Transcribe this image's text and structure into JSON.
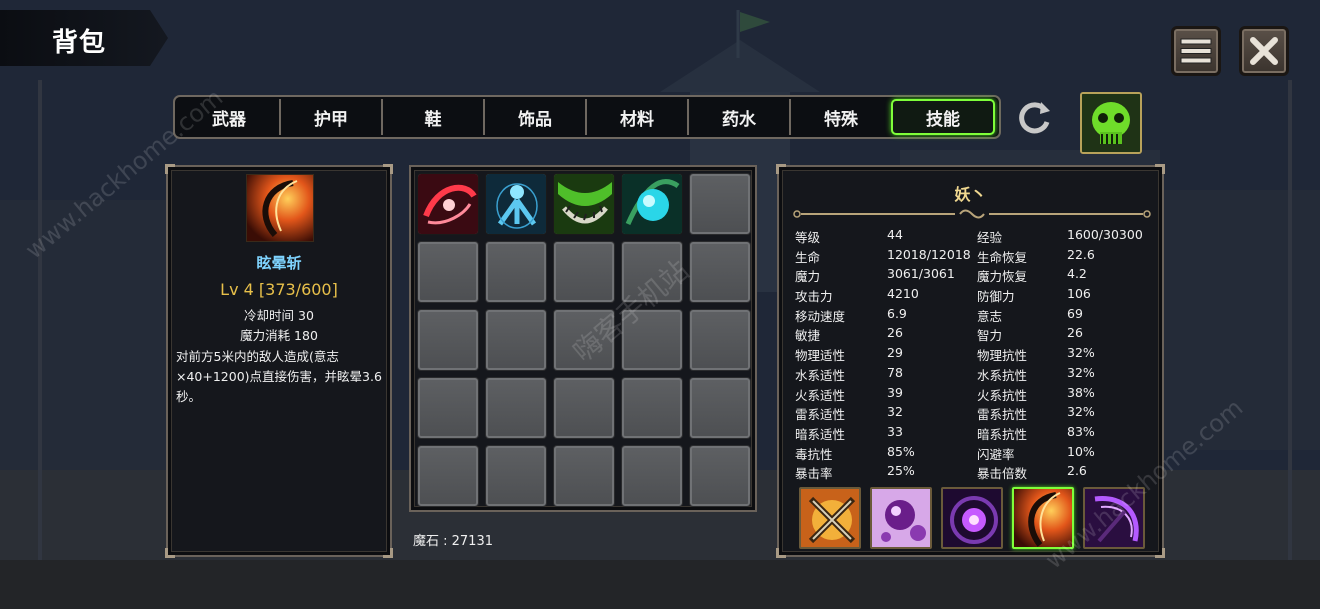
{
  "header": {
    "title": "背包"
  },
  "top_buttons": [
    {
      "icon": "menu-icon"
    },
    {
      "icon": "close-icon"
    }
  ],
  "tabs": [
    {
      "label": "武器",
      "active": false
    },
    {
      "label": "护甲",
      "active": false
    },
    {
      "label": "鞋",
      "active": false
    },
    {
      "label": "饰品",
      "active": false
    },
    {
      "label": "材料",
      "active": false
    },
    {
      "label": "药水",
      "active": false
    },
    {
      "label": "特殊",
      "active": false
    },
    {
      "label": "技能",
      "active": true
    }
  ],
  "skill_detail": {
    "name": "眩晕斩",
    "level": "Lv 4 [373/600]",
    "cooldown": "冷却时间 30",
    "mana_cost": "魔力消耗 180",
    "description": "对前方5米内的敌人造成(意志×40+1200)点直接伤害，并眩晕3.6秒。",
    "icon": "scythe-slash-icon"
  },
  "inventory": {
    "slots_total": 25,
    "filled_icons": [
      "red-slash-icon",
      "blue-spirit-icon",
      "green-jaw-icon",
      "cyan-orb-icon"
    ],
    "currency": "魔石 : 27131"
  },
  "character": {
    "name": "妖丶",
    "stats": [
      [
        "等级",
        "44",
        "经验",
        "1600/30300"
      ],
      [
        "生命",
        "12018/12018",
        "生命恢复",
        "22.6"
      ],
      [
        "魔力",
        "3061/3061",
        "魔力恢复",
        "4.2"
      ],
      [
        "攻击力",
        "4210",
        "防御力",
        "106"
      ],
      [
        "移动速度",
        "6.9",
        "意志",
        "69"
      ],
      [
        "敏捷",
        "26",
        "智力",
        "26"
      ],
      [
        "物理适性",
        "29",
        "物理抗性",
        "32%"
      ],
      [
        "水系适性",
        "78",
        "水系抗性",
        "32%"
      ],
      [
        "火系适性",
        "39",
        "火系抗性",
        "38%"
      ],
      [
        "雷系适性",
        "32",
        "雷系抗性",
        "32%"
      ],
      [
        "暗系适性",
        "33",
        "暗系抗性",
        "83%"
      ],
      [
        "毒抗性",
        "85%",
        "闪避率",
        "10%"
      ],
      [
        "暴击率",
        "25%",
        "暴击倍数",
        "2.6"
      ]
    ],
    "equipped_skills": [
      {
        "icon": "crossed-swords-icon",
        "active": false
      },
      {
        "icon": "purple-bubbles-icon",
        "active": false
      },
      {
        "icon": "dark-vortex-icon",
        "active": false
      },
      {
        "icon": "scythe-slash-icon",
        "active": true
      },
      {
        "icon": "purple-scythe-icon",
        "active": false
      }
    ]
  },
  "watermarks": [
    "www.hackhome.com",
    "嗨客手机站",
    "www.hackhome.com"
  ],
  "colors": {
    "active_tab": "#7fff3a",
    "skill_name": "#7fd4ff",
    "level": "#e8c04a",
    "char_name": "#f0d890"
  }
}
